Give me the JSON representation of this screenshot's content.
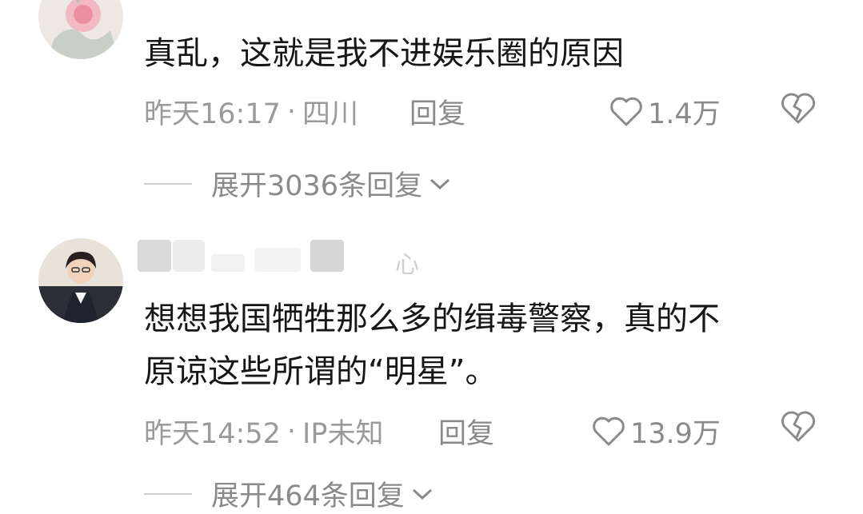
{
  "comments": [
    {
      "username_fragment": "",
      "text": "真乱，这就是我不进娱乐圈的原因",
      "time": "昨天16:17",
      "separator": "·",
      "location": "四川",
      "reply_label": "回复",
      "likes": "1.4万",
      "expand_label": "展开3036条回复"
    },
    {
      "username_fragment": "心",
      "text": "想想我国牺牲那么多的缉毒警察，真的不\n原谅这些所谓的“明星”。",
      "time": "昨天14:52",
      "separator": "·",
      "location": "IP未知",
      "reply_label": "回复",
      "likes": "13.9万",
      "expand_label": "展开464条回复"
    }
  ],
  "colors": {
    "text_primary": "#161616",
    "text_secondary": "#9a9a9a",
    "icon_gray": "#8a8a8a",
    "background": "#ffffff"
  },
  "icons": [
    "heart-icon",
    "broken-heart-icon",
    "chevron-down-icon"
  ]
}
